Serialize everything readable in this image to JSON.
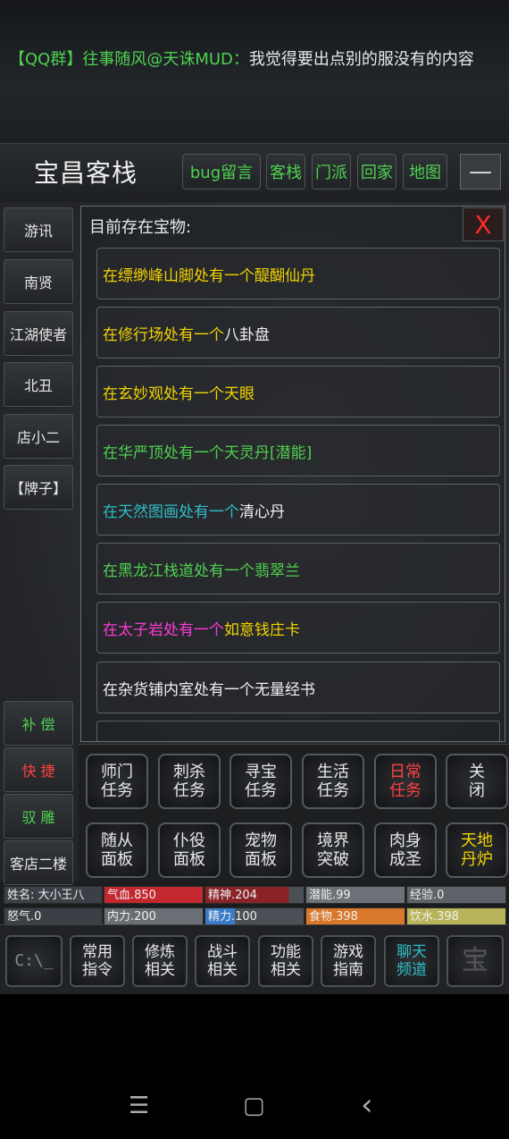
{
  "chat": {
    "tag": "【QQ群】",
    "speaker": "往事随风@天诛MUD：",
    "message": "我觉得要出点别的服没有的内容"
  },
  "room": {
    "title": "宝昌客栈",
    "nav_buttons": [
      "bug留言",
      "客栈",
      "门派",
      "回家",
      "地图"
    ],
    "minimize": "—"
  },
  "npcs": [
    "游讯",
    "南贤",
    "江湖使者",
    "北丑",
    "店小二",
    "【牌子】"
  ],
  "side_actions": [
    "补 偿",
    "快 捷",
    "驭 雕",
    "客店二楼"
  ],
  "panel": {
    "heading": "目前存在宝物:",
    "close": "X",
    "items": [
      {
        "place": "在缥缈峰山脚处有一个",
        "treasure": "醍醐仙丹",
        "place_color": "#f2d200",
        "treasure_color": "#f2d200"
      },
      {
        "place": "在修行场处有一个",
        "treasure": "八卦盘",
        "place_color": "#f2d200",
        "treasure_color": "#f0f0f0"
      },
      {
        "place": "在玄妙观处有一个",
        "treasure": "天眼",
        "place_color": "#f2d200",
        "treasure_color": "#f2d200"
      },
      {
        "place": "在华严顶处有一个",
        "treasure": "天灵丹[潜能]",
        "place_color": "#4fd14f",
        "treasure_color": "#4fd14f"
      },
      {
        "place": "在天然图画处有一个",
        "treasure": "清心丹",
        "place_color": "#2fbfc8",
        "treasure_color": "#f0f0f0"
      },
      {
        "place": "在黑龙江栈道处有一个",
        "treasure": "翡翠兰",
        "place_color": "#4fd14f",
        "treasure_color": "#4fd14f"
      },
      {
        "place": "在太子岩处有一个",
        "treasure": "如意钱庄卡",
        "place_color": "#ff3ad8",
        "treasure_color": "#f2d200"
      },
      {
        "place": "在杂货铺内室处有一个",
        "treasure": "无量经书",
        "place_color": "#f0f0f0",
        "treasure_color": "#f0f0f0"
      }
    ]
  },
  "quick_buttons": [
    [
      "师门",
      "任务"
    ],
    [
      "刺杀",
      "任务"
    ],
    [
      "寻宝",
      "任务"
    ],
    [
      "生活",
      "任务"
    ],
    [
      "日常",
      "任务"
    ],
    [
      "关",
      "闭"
    ],
    [
      "随从",
      "面板"
    ],
    [
      "仆役",
      "面板"
    ],
    [
      "宠物",
      "面板"
    ],
    [
      "境界",
      "突破"
    ],
    [
      "肉身",
      "成圣"
    ],
    [
      "天地",
      "丹炉"
    ]
  ],
  "stats": [
    {
      "label": "姓名: 大小王八",
      "color": "#3a4046",
      "fill": 1.0
    },
    {
      "label": "气血.850",
      "color": "#c2282e",
      "fill": 1.0
    },
    {
      "label": "精神.204",
      "color": "#8a2328",
      "fill": 0.85
    },
    {
      "label": "潜能.99",
      "color": "#6c7278",
      "fill": 1.0
    },
    {
      "label": "经验.0",
      "color": "#5d6368",
      "fill": 1.0
    },
    {
      "label": "怒气.0",
      "color": "#3a4046",
      "fill": 1.0
    },
    {
      "label": "内力.200",
      "color": "#6a6f75",
      "fill": 1.0
    },
    {
      "label": "精力.100",
      "color": "#3a7cc8",
      "fill": 0.3
    },
    {
      "label": "食物.398",
      "color": "#d9782a",
      "fill": 1.0
    },
    {
      "label": "饮水.398",
      "color": "#b8b45a",
      "fill": 1.0
    }
  ],
  "bottom_menu": [
    [
      "常用",
      "指令"
    ],
    [
      "修炼",
      "相关"
    ],
    [
      "战斗",
      "相关"
    ],
    [
      "功能",
      "相关"
    ],
    [
      "游戏",
      "指南"
    ],
    [
      "聊天",
      "频道"
    ]
  ],
  "bottom_icons": {
    "left": "C:\\_",
    "right": "宝"
  },
  "system_nav": {
    "menu": "☰",
    "home": "▢",
    "back": "‹"
  }
}
